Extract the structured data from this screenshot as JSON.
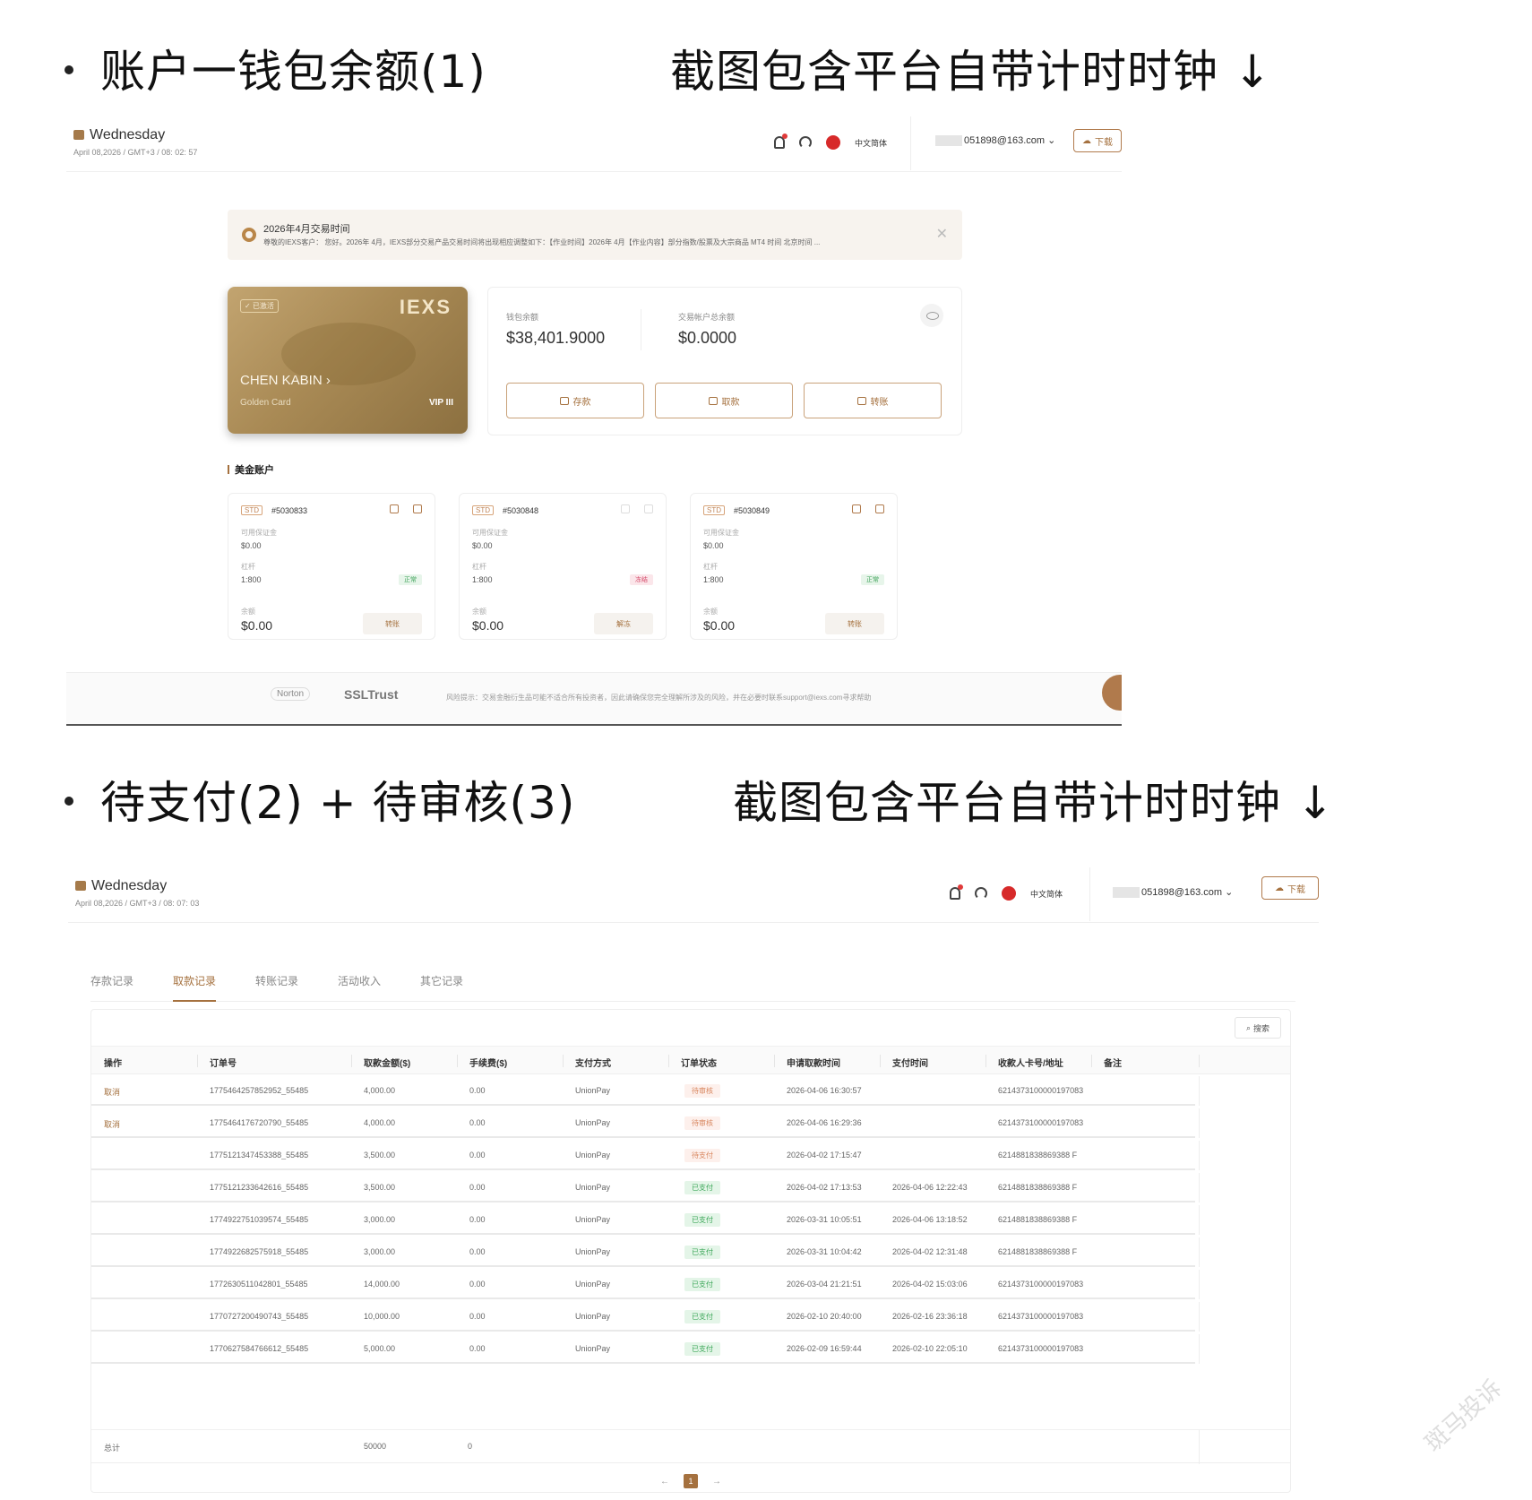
{
  "headings": {
    "sec1_title": "账户一钱包余额(1)",
    "sec1_note": "截图包含平台自带计时时钟 ↓",
    "sec2_title": "待支付(2) +  待审核(3)",
    "sec2_note": "截图包含平台自带计时时钟 ↓"
  },
  "shot1": {
    "topbar": {
      "day": "Wednesday",
      "date": "April 08,2026 / GMT+3 / 08: 02: 57",
      "lang": "中文简体",
      "account": "051898@163.com",
      "download": "下载"
    },
    "notice": {
      "title": "2026年4月交易时间",
      "text": "尊敬的IEXS客户：  您好。2026年 4月，IEXS部分交易产品交易时间将出现相应调整如下：【作业时间】2026年 4月【作业内容】部分指数/股票及大宗商品  MT4 时间 北京时间 ..."
    },
    "card": {
      "badge": "✓ 已激活",
      "brand": "IEXS",
      "holder": "CHEN KABIN",
      "type": "Golden Card",
      "vip": "VIP III"
    },
    "wallet": {
      "wallet_label": "钱包余额",
      "wallet_value": "$38,401.9000",
      "trade_label": "交易帐户总余额",
      "trade_value": "$0.0000",
      "btn_deposit": "存款",
      "btn_withdraw": "取款",
      "btn_transfer": "转账"
    },
    "usd_title": "美金账户",
    "accounts": [
      {
        "tag": "STD",
        "number": "#5030833",
        "margin_label": "可用保证金",
        "margin": "$0.00",
        "leverage_label": "杠杆",
        "leverage": "1:800",
        "status": "正常",
        "balance_label": "余额",
        "balance": "$0.00",
        "action": "转账"
      },
      {
        "tag": "STD",
        "number": "#5030848",
        "margin_label": "可用保证金",
        "margin": "$0.00",
        "leverage_label": "杠杆",
        "leverage": "1:800",
        "status": "冻结",
        "balance_label": "余额",
        "balance": "$0.00",
        "action": "解冻"
      },
      {
        "tag": "STD",
        "number": "#5030849",
        "margin_label": "可用保证金",
        "margin": "$0.00",
        "leverage_label": "杠杆",
        "leverage": "1:800",
        "status": "正常",
        "balance_label": "余额",
        "balance": "$0.00",
        "action": "转账"
      }
    ],
    "footer": {
      "norton": "Norton",
      "ssl": "SSLTrust",
      "risk": "风险提示：交易金融衍生品可能不适合所有投资者，因此请确保您完全理解所涉及的风险，并在必要时联系support@iexs.com寻求帮助"
    }
  },
  "shot2": {
    "topbar": {
      "day": "Wednesday",
      "date": "April 08,2026 / GMT+3 / 08: 07: 03",
      "lang": "中文简体",
      "account": "051898@163.com",
      "download": "下载"
    },
    "tabs": [
      "存款记录",
      "取款记录",
      "转账记录",
      "活动收入",
      "其它记录"
    ],
    "active_tab": "取款记录",
    "search": "搜索",
    "columns": [
      "操作",
      "订单号",
      "取款金额($)",
      "手续费($)",
      "支付方式",
      "订单状态",
      "申请取款时间",
      "支付时间",
      "收款人卡号/地址",
      "备注"
    ],
    "rows": [
      {
        "op": "取消",
        "order": "1775464257852952_55485",
        "amount": "4,000.00",
        "fee": "0.00",
        "method": "UnionPay",
        "status": "待审核",
        "applied": "2026-04-06 16:30:57",
        "paid": "",
        "card": "6214373100000197083"
      },
      {
        "op": "取消",
        "order": "1775464176720790_55485",
        "amount": "4,000.00",
        "fee": "0.00",
        "method": "UnionPay",
        "status": "待审核",
        "applied": "2026-04-06 16:29:36",
        "paid": "",
        "card": "6214373100000197083"
      },
      {
        "op": "",
        "order": "1775121347453388_55485",
        "amount": "3,500.00",
        "fee": "0.00",
        "method": "UnionPay",
        "status": "待支付",
        "applied": "2026-04-02 17:15:47",
        "paid": "",
        "card": "6214881838869388 F"
      },
      {
        "op": "",
        "order": "1775121233642616_55485",
        "amount": "3,500.00",
        "fee": "0.00",
        "method": "UnionPay",
        "status": "已支付",
        "applied": "2026-04-02 17:13:53",
        "paid": "2026-04-06 12:22:43",
        "card": "6214881838869388 F"
      },
      {
        "op": "",
        "order": "1774922751039574_55485",
        "amount": "3,000.00",
        "fee": "0.00",
        "method": "UnionPay",
        "status": "已支付",
        "applied": "2026-03-31 10:05:51",
        "paid": "2026-04-06 13:18:52",
        "card": "6214881838869388 F"
      },
      {
        "op": "",
        "order": "1774922682575918_55485",
        "amount": "3,000.00",
        "fee": "0.00",
        "method": "UnionPay",
        "status": "已支付",
        "applied": "2026-03-31 10:04:42",
        "paid": "2026-04-02 12:31:48",
        "card": "6214881838869388 F"
      },
      {
        "op": "",
        "order": "1772630511042801_55485",
        "amount": "14,000.00",
        "fee": "0.00",
        "method": "UnionPay",
        "status": "已支付",
        "applied": "2026-03-04 21:21:51",
        "paid": "2026-04-02 15:03:06",
        "card": "6214373100000197083"
      },
      {
        "op": "",
        "order": "1770727200490743_55485",
        "amount": "10,000.00",
        "fee": "0.00",
        "method": "UnionPay",
        "status": "已支付",
        "applied": "2026-02-10 20:40:00",
        "paid": "2026-02-16 23:36:18",
        "card": "6214373100000197083"
      },
      {
        "op": "",
        "order": "1770627584766612_55485",
        "amount": "5,000.00",
        "fee": "0.00",
        "method": "UnionPay",
        "status": "已支付",
        "applied": "2026-02-09 16:59:44",
        "paid": "2026-02-10 22:05:10",
        "card": "6214373100000197083"
      }
    ],
    "total": {
      "label": "总计",
      "amount": "50000",
      "fee": "0"
    },
    "page": "1"
  },
  "watermark": "斑马投诉",
  "colors": {
    "accent": "#a5713f",
    "paid": "#3ea85a",
    "pending": "#d8865e",
    "frozen": "#d54a6a"
  }
}
